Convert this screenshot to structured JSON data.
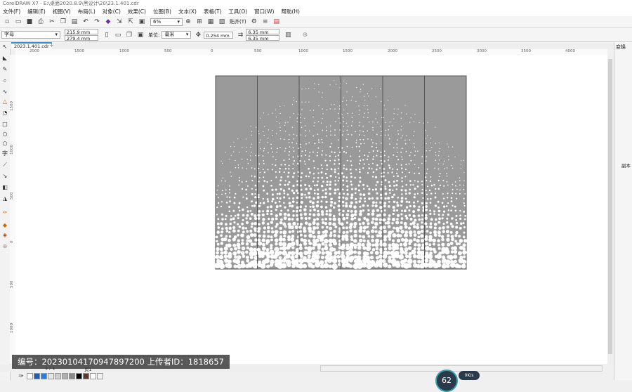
{
  "window": {
    "title": "CorelDRAW X7 - E:\\桌面2020.8.9\\黑设计\\20\\23.1.401.cdr"
  },
  "menu": [
    "文件(F)",
    "编辑(E)",
    "视图(V)",
    "布局(L)",
    "对象(C)",
    "效果(C)",
    "位图(B)",
    "文本(X)",
    "表格(T)",
    "工具(O)",
    "窗口(W)",
    "帮助(H)"
  ],
  "toolbar": {
    "zoom": "6%",
    "snap_label": "贴齐(T)"
  },
  "property_bar": {
    "font_label": "字母",
    "width": "215.9 mm",
    "height": "279.4 mm",
    "units_label": "单位:",
    "units_value": "毫米",
    "nudge": "0.254 mm",
    "dup_x": "6.35 mm",
    "dup_y": "6.35 mm"
  },
  "document_tab": "2023.1.401.cdr",
  "right_dock": {
    "title": "变换",
    "side_label": "副本"
  },
  "hruler_ticks": [
    "2000",
    "1500",
    "1000",
    "500",
    "0",
    "500",
    "1000",
    "1500",
    "2000",
    "2500",
    "3000",
    "3500",
    "4000"
  ],
  "vruler_ticks": [
    "1500",
    "1000",
    "500",
    "0",
    "500",
    "1000"
  ],
  "status": {
    "page_counter": "1 / 1",
    "page_label": "页1"
  },
  "watermark": "编号：20230104170947897200 上传者ID：1818657",
  "badge": {
    "value": "62",
    "sub": "0K/s"
  },
  "colors": {
    "panel": "#9a9a9a",
    "panel_border": "#555555",
    "accent": "#3b8fd6"
  }
}
